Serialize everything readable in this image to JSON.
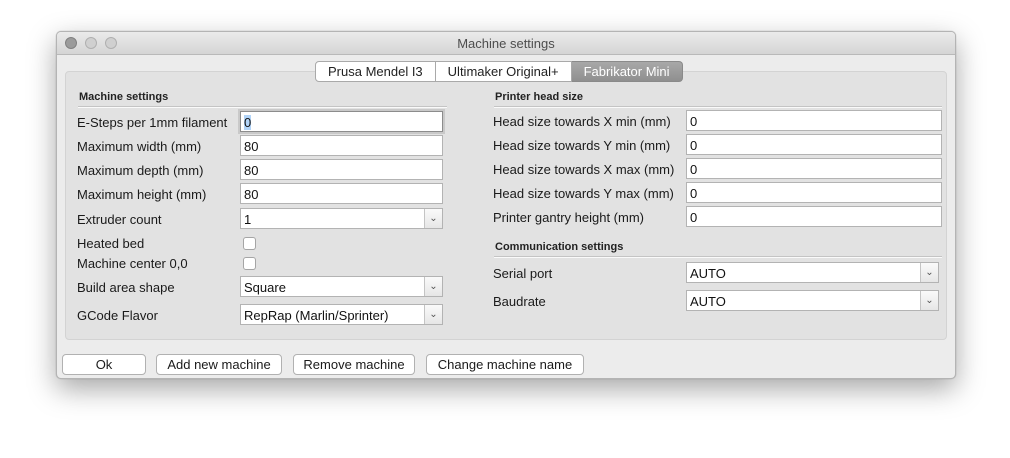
{
  "window": {
    "title": "Machine settings"
  },
  "tabs": [
    "Prusa Mendel I3",
    "Ultimaker Original+",
    "Fabrikator Mini"
  ],
  "active_tab": "Fabrikator Mini",
  "machine": {
    "section_title": "Machine settings",
    "esteps": {
      "label": "E-Steps per 1mm filament",
      "value": "0"
    },
    "max_width": {
      "label": "Maximum width (mm)",
      "value": "80"
    },
    "max_depth": {
      "label": "Maximum depth (mm)",
      "value": "80"
    },
    "max_height": {
      "label": "Maximum height (mm)",
      "value": "80"
    },
    "extruder_count": {
      "label": "Extruder count",
      "value": "1"
    },
    "heated_bed": {
      "label": "Heated bed",
      "checked": false
    },
    "machine_center": {
      "label": "Machine center 0,0",
      "checked": false
    },
    "build_area_shape": {
      "label": "Build area shape",
      "value": "Square"
    },
    "gcode_flavor": {
      "label": "GCode Flavor",
      "value": "RepRap (Marlin/Sprinter)"
    }
  },
  "head": {
    "section_title": "Printer head size",
    "x_min": {
      "label": "Head size towards X min (mm)",
      "value": "0"
    },
    "y_min": {
      "label": "Head size towards Y min (mm)",
      "value": "0"
    },
    "x_max": {
      "label": "Head size towards X max (mm)",
      "value": "0"
    },
    "y_max": {
      "label": "Head size towards Y max (mm)",
      "value": "0"
    },
    "gantry": {
      "label": "Printer gantry height (mm)",
      "value": "0"
    }
  },
  "comm": {
    "section_title": "Communication settings",
    "serial_port": {
      "label": "Serial port",
      "value": "AUTO"
    },
    "baudrate": {
      "label": "Baudrate",
      "value": "AUTO"
    }
  },
  "buttons": {
    "ok": "Ok",
    "add": "Add new machine",
    "remove": "Remove machine",
    "rename": "Change machine name"
  },
  "icons": {
    "dropdown": "chevron-down-icon",
    "window_controls": [
      "close-icon",
      "minimize-icon",
      "zoom-icon"
    ]
  }
}
